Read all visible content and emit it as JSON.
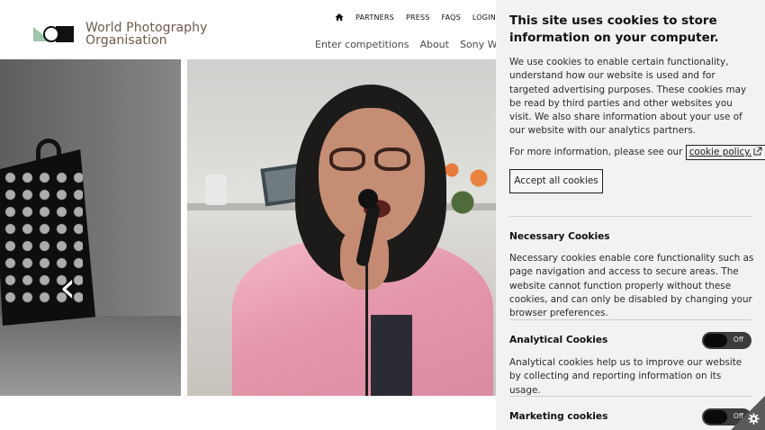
{
  "header": {
    "logo_line1": "World Photography",
    "logo_line2": "Organisation",
    "top_links": [
      "PARTNERS",
      "PRESS",
      "FAQS",
      "LOGIN"
    ],
    "main_links": [
      "Enter competitions",
      "About",
      "Sony World"
    ]
  },
  "hero": {
    "prev_arrow": "‹"
  },
  "cookie_panel": {
    "title": "This site uses cookies to store information on your computer.",
    "body": "We use cookies to enable certain functionality, understand how our website is used and for targeted advertising purposes. These cookies may be read by third parties and other websites you visit. We also share information about your use of our website with our analytics partners.",
    "more_prefix": "For more information, please see our ",
    "more_link": "cookie policy.",
    "accept_label": "Accept all cookies",
    "sections": [
      {
        "title": "Necessary Cookies",
        "body": "Necessary cookies enable core functionality such as page navigation and access to secure areas. The website cannot function properly without these cookies, and can only be disabled by changing your browser preferences."
      },
      {
        "title": "Analytical Cookies",
        "toggle": "Off",
        "body": "Analytical cookies help us to improve our website by collecting and reporting information on its usage."
      },
      {
        "title": "Marketing cookies",
        "toggle": "Off"
      }
    ]
  },
  "icons": {
    "home": "home-icon",
    "external_link": "external-link-icon",
    "settings": "gear-icon"
  },
  "colors": {
    "logo_green": "#9ec5ad",
    "logo_text": "#6d5a4a",
    "panel_bg": "#f2f2f2",
    "toggle_off": "#3c3c3c"
  }
}
